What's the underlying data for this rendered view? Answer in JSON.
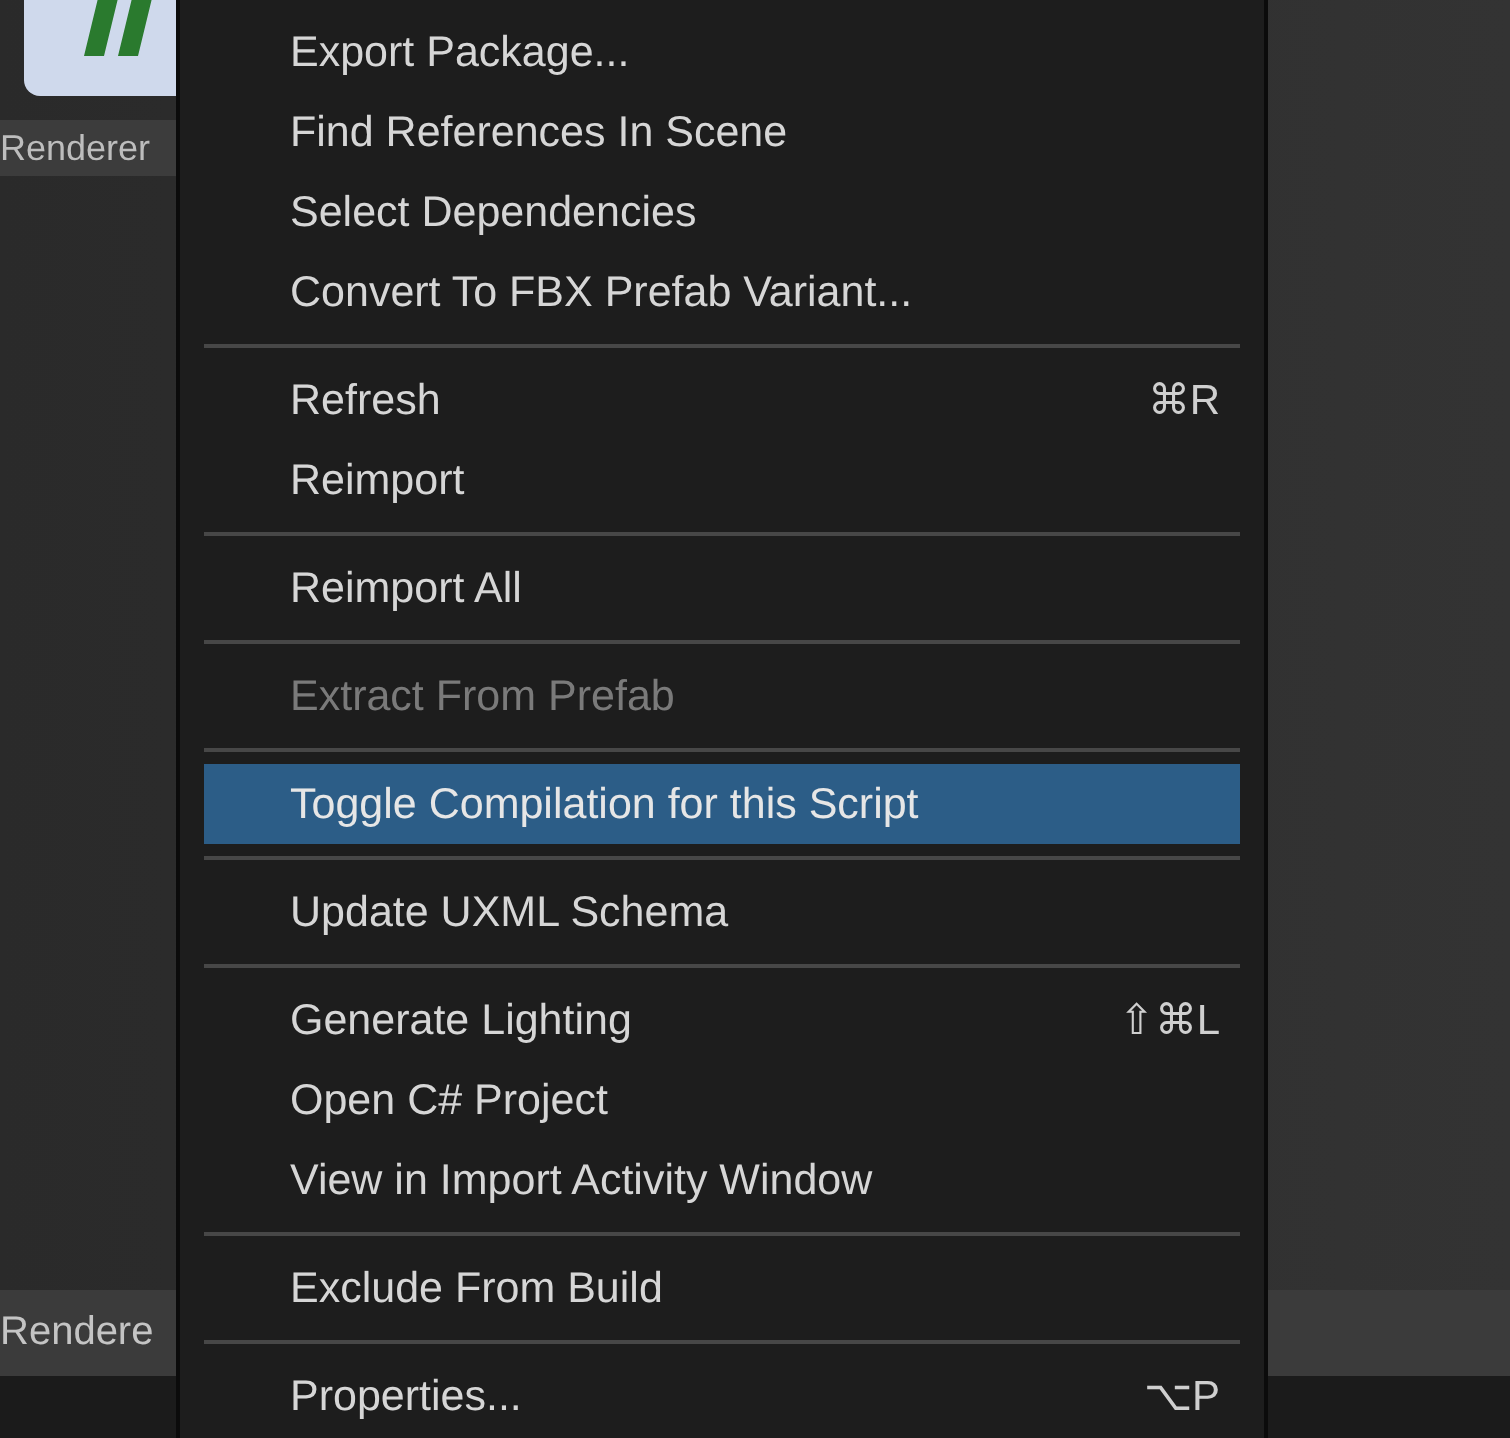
{
  "assets": [
    {
      "label": "Renderer"
    }
  ],
  "bottom_bar": {
    "label": "Rendere"
  },
  "context_menu": {
    "items": [
      {
        "kind": "item",
        "label": "Export Package...",
        "disabled": false,
        "selected": false
      },
      {
        "kind": "item",
        "label": "Find References In Scene",
        "disabled": false,
        "selected": false
      },
      {
        "kind": "item",
        "label": "Select Dependencies",
        "disabled": false,
        "selected": false
      },
      {
        "kind": "item",
        "label": "Convert To FBX Prefab Variant...",
        "disabled": false,
        "selected": false
      },
      {
        "kind": "separator"
      },
      {
        "kind": "item",
        "label": "Refresh",
        "shortcut": "⌘R",
        "disabled": false,
        "selected": false
      },
      {
        "kind": "item",
        "label": "Reimport",
        "disabled": false,
        "selected": false
      },
      {
        "kind": "separator"
      },
      {
        "kind": "item",
        "label": "Reimport All",
        "disabled": false,
        "selected": false
      },
      {
        "kind": "separator"
      },
      {
        "kind": "item",
        "label": "Extract From Prefab",
        "disabled": true,
        "selected": false
      },
      {
        "kind": "separator"
      },
      {
        "kind": "item",
        "label": "Toggle Compilation for this Script",
        "disabled": false,
        "selected": true
      },
      {
        "kind": "separator"
      },
      {
        "kind": "item",
        "label": "Update UXML Schema",
        "disabled": false,
        "selected": false
      },
      {
        "kind": "separator"
      },
      {
        "kind": "item",
        "label": "Generate Lighting",
        "shortcut": "⇧⌘L",
        "disabled": false,
        "selected": false
      },
      {
        "kind": "item",
        "label": "Open C# Project",
        "disabled": false,
        "selected": false
      },
      {
        "kind": "item",
        "label": "View in Import Activity Window",
        "disabled": false,
        "selected": false
      },
      {
        "kind": "separator"
      },
      {
        "kind": "item",
        "label": "Exclude From Build",
        "disabled": false,
        "selected": false
      },
      {
        "kind": "separator"
      },
      {
        "kind": "item",
        "label": "Properties...",
        "shortcut": "⌥P",
        "disabled": false,
        "selected": false
      }
    ]
  }
}
